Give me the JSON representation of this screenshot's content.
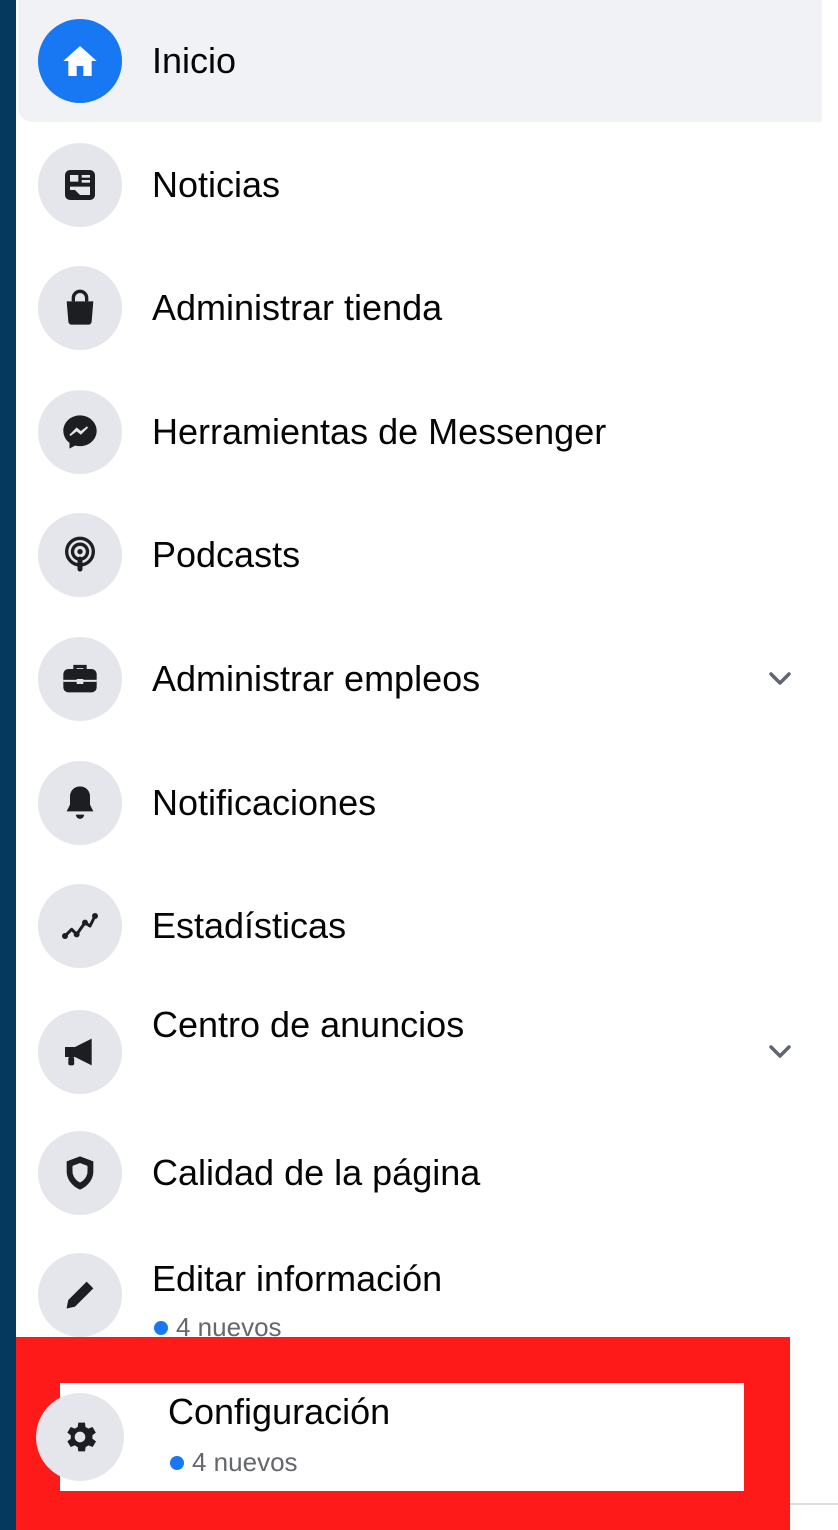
{
  "menu": {
    "items": [
      {
        "label": "Inicio",
        "icon": "home-icon"
      },
      {
        "label": "Noticias",
        "icon": "news-feed-icon"
      },
      {
        "label": "Administrar tienda",
        "icon": "shopping-bag-icon"
      },
      {
        "label": "Herramientas de Messenger",
        "icon": "messenger-icon"
      },
      {
        "label": "Podcasts",
        "icon": "podcast-icon"
      },
      {
        "label": "Administrar empleos",
        "icon": "briefcase-icon"
      },
      {
        "label": "Notificaciones",
        "icon": "bell-icon"
      },
      {
        "label": "Estadísticas",
        "icon": "insights-icon"
      },
      {
        "label": "Centro de anuncios",
        "icon": "megaphone-icon"
      },
      {
        "label": "Calidad de la página",
        "icon": "shield-icon"
      },
      {
        "label": "Editar información",
        "icon": "pencil-icon",
        "badge": "4 nuevos"
      },
      {
        "label": "Configuración",
        "icon": "gear-icon",
        "badge": "4 nuevos"
      }
    ]
  },
  "colors": {
    "accent": "#1877f2",
    "highlight": "#ff1a1a",
    "outer_background": "#053a5e",
    "icon_background": "#e4e6eb"
  }
}
